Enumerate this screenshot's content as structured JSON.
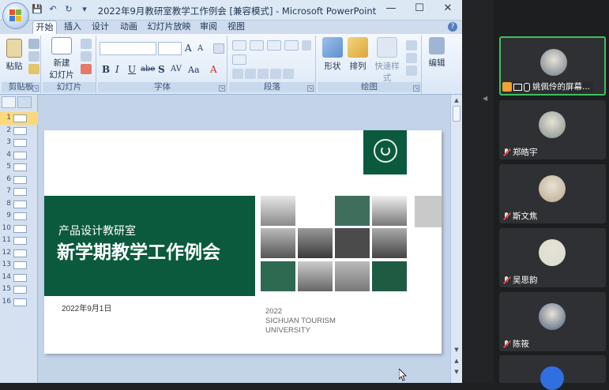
{
  "window": {
    "title": "2022年9月教研室教学工作例会 [兼容模式] - Microsoft PowerPoint",
    "controls": [
      "—",
      "☐",
      "✕"
    ]
  },
  "ribbon_tabs": [
    "开始",
    "插入",
    "设计",
    "动画",
    "幻灯片放映",
    "审阅",
    "视图"
  ],
  "active_tab": "开始",
  "groups": {
    "clipboard": {
      "label": "剪贴板",
      "paste": "粘贴"
    },
    "slides": {
      "label": "幻灯片",
      "new_slide_1": "新建",
      "new_slide_2": "幻灯片 ▾"
    },
    "font": {
      "label": "字体",
      "bold": "B",
      "italic": "I",
      "underline": "U",
      "strike": "abe",
      "shadow": "S",
      "spacing": "AV",
      "case": "Aa",
      "grow": "A",
      "shrink": "A"
    },
    "paragraph": {
      "label": "段落"
    },
    "drawing": {
      "label": "绘图",
      "shape": "形状",
      "arrange": "排列",
      "quick_styles": "快速样式"
    },
    "editing": {
      "label": "",
      "edit": "编辑"
    }
  },
  "slide_thumbs": [
    "1",
    "2",
    "3",
    "4",
    "5",
    "6",
    "7",
    "8",
    "9",
    "10",
    "11",
    "12",
    "13",
    "14",
    "15",
    "16"
  ],
  "selected_slide": "1",
  "slide": {
    "subtitle": "产品设计教研室",
    "title": "新学期教学工作例会",
    "date": "2022年9月1日",
    "year": "2022",
    "uni1": "SICHUAN TOURISM",
    "uni2": "UNIVERSITY"
  },
  "participants": [
    {
      "name": "姚佩伶的屏幕...",
      "active": true,
      "avatar_color": "#6b7a88"
    },
    {
      "name": "郑皓宇",
      "active": false,
      "avatar_color": "#7d8f8a"
    },
    {
      "name": "斯文焦",
      "active": false,
      "avatar_color": "#b8a88a"
    },
    {
      "name": "吴思韵",
      "active": false,
      "avatar_color": "#d8dccf"
    },
    {
      "name": "陈筱",
      "active": false,
      "avatar_color": "#4a5f7d"
    }
  ],
  "colors": {
    "slide_green": "#0b5a3e",
    "active_border": "#3fbf5f",
    "selected_thumb": "#fbd97a"
  }
}
